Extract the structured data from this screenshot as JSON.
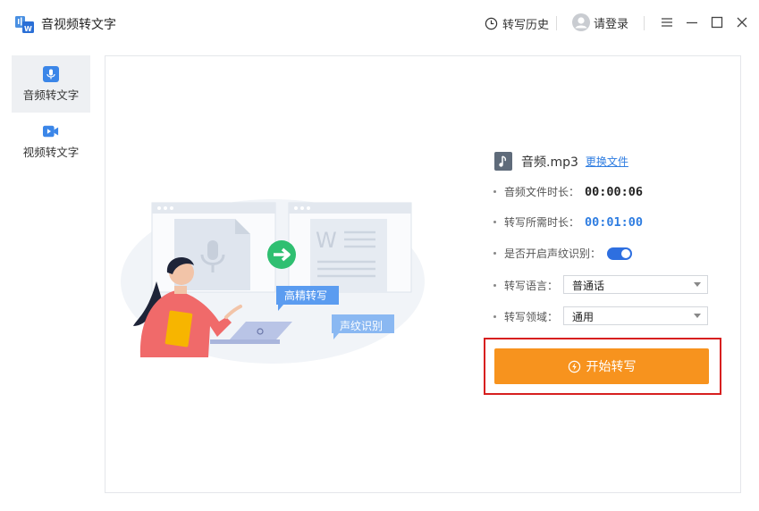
{
  "app": {
    "title": "音视频转文字"
  },
  "header": {
    "history_label": "转写历史",
    "login_label": "请登录"
  },
  "sidebar": {
    "items": [
      {
        "label": "音频转文字",
        "icon": "microphone-icon",
        "active": true
      },
      {
        "label": "视频转文字",
        "icon": "video-camera-icon",
        "active": false
      }
    ]
  },
  "illustration": {
    "bubble_hd": "高精转写",
    "bubble_voiceprint": "声纹识别"
  },
  "file": {
    "name": "音频.mp3",
    "change_link": "更换文件",
    "icon": "music-note-icon"
  },
  "info": {
    "duration_label": "音频文件时长：",
    "duration_value": "00:00:06",
    "est_label": "转写所需时长：",
    "est_value": "00:01:00",
    "voiceprint_label": "是否开启声纹识别：",
    "voiceprint_enabled": true,
    "language_label": "转写语言：",
    "language_value": "普通话",
    "domain_label": "转写领域：",
    "domain_value": "通用"
  },
  "action": {
    "start_label": "开始转写"
  },
  "colors": {
    "accent_blue": "#2f7de1",
    "start_orange": "#f7931e",
    "highlight_red": "#d71f1f",
    "toggle_blue": "#2e6fe0"
  }
}
